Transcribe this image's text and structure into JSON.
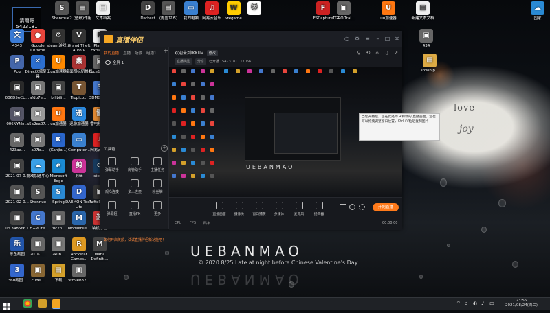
{
  "desktop": {
    "icons": [
      {
        "label": "4343",
        "color": "#3a7bd5",
        "glyph": "文"
      },
      {
        "label": "Pcq",
        "color": "#4466aa",
        "glyph": "P"
      },
      {
        "label": "006D5eCU...",
        "color": "#2a2a2a",
        "glyph": "▣"
      },
      {
        "label": "006NYMe...",
        "color": "#555566",
        "glyph": "▣"
      },
      {
        "label": "423aa...",
        "color": "#666",
        "glyph": "▣"
      },
      {
        "label": "2021-07-0...",
        "color": "#444",
        "glyph": "▣"
      },
      {
        "label": "2021-02-0...",
        "color": "#555",
        "glyph": "▣"
      },
      {
        "label": "uri.348566...",
        "color": "#444",
        "glyph": "▣"
      },
      {
        "label": "乐鱼截图",
        "color": "#2255aa",
        "glyph": "乐"
      },
      {
        "label": "360截图...",
        "color": "#3366cc",
        "glyph": "3"
      },
      {
        "label": "Google Chrome",
        "color": "#e8453c",
        "glyph": "●"
      },
      {
        "label": "DirectX修复工具",
        "color": "#2c6fcf",
        "glyph": "✕"
      },
      {
        "label": "afdb7e...",
        "color": "#777",
        "glyph": "▣"
      },
      {
        "label": "a5a2ca07...",
        "color": "#999",
        "glyph": "▣"
      },
      {
        "label": "a07b...",
        "color": "#777",
        "glyph": "▣"
      },
      {
        "label": "游戏加速中心",
        "color": "#3aa0e8",
        "glyph": "☁"
      },
      {
        "label": "Shennue",
        "color": "#555",
        "glyph": "S"
      },
      {
        "label": "CH+PLite...",
        "color": "#4477cc",
        "glyph": "C"
      },
      {
        "label": "20161...",
        "color": "#666",
        "glyph": "▣"
      },
      {
        "label": "cube...",
        "color": "#886633",
        "glyph": "▣"
      },
      {
        "label": "steam游戏...",
        "color": "#333",
        "glyph": "⚙"
      },
      {
        "label": "uu加速器",
        "color": "#ff8a00",
        "glyph": "U"
      },
      {
        "label": "bilibili...",
        "color": "#444",
        "glyph": "▣"
      },
      {
        "label": "uu加速器",
        "color": "#ff7711",
        "glyph": "U"
      },
      {
        "label": "(Kanjia...)",
        "color": "#2a66cc",
        "glyph": "K"
      },
      {
        "label": "Microsoft Edge",
        "color": "#1a8ad4",
        "glyph": "e"
      },
      {
        "label": "Spring",
        "color": "#2a8ad4",
        "glyph": "S"
      },
      {
        "label": "ruc2n...",
        "color": "#666",
        "glyph": "▣"
      },
      {
        "label": "2kun...",
        "color": "#777",
        "glyph": "▣"
      },
      {
        "label": "下载",
        "color": "#d4a02a",
        "glyph": "▤"
      },
      {
        "label": "Grand Theft Auto V",
        "color": "#333",
        "glyph": "V"
      },
      {
        "label": "桌面图标切换器",
        "color": "#aa3333",
        "glyph": "桌"
      },
      {
        "label": "Tropico...",
        "color": "#775533",
        "glyph": "T"
      },
      {
        "label": "迅游加速器",
        "color": "#2a88dd",
        "glyph": "迅"
      },
      {
        "label": "Computer...",
        "color": "#3a80d0",
        "glyph": "▭"
      },
      {
        "label": "剪辑",
        "color": "#cc3399",
        "glyph": "剪"
      },
      {
        "label": "DAEMON Tools Lite",
        "color": "#3366cc",
        "glyph": "D"
      },
      {
        "label": "MobileFile...",
        "color": "#2a66aa",
        "glyph": "M"
      },
      {
        "label": "Rockstar Games...",
        "color": "#dd9922",
        "glyph": "R"
      },
      {
        "label": "9fd9eb37...",
        "color": "#666",
        "glyph": "▣"
      },
      {
        "label": "Planet Explorers",
        "color": "#eeeeee",
        "glyph": "P"
      },
      {
        "label": "2bce1153...",
        "color": "#666",
        "glyph": "▣"
      },
      {
        "label": "3DMGAM...",
        "color": "#4477cc",
        "glyph": "3"
      },
      {
        "label": "雷电模拟器",
        "color": "#dd8833",
        "glyph": "雷"
      },
      {
        "label": "网易云音乐",
        "color": "#dd2222",
        "glyph": "♫"
      },
      {
        "label": "steam",
        "color": "#173a5e",
        "glyph": "⚙"
      },
      {
        "label": "RaffeRide...",
        "color": "#333",
        "glyph": "▣"
      },
      {
        "label": "装机必备",
        "color": "#cc3333",
        "glyph": "装"
      },
      {
        "label": "Mafia Definiti...",
        "color": "#444",
        "glyph": "M"
      },
      {
        "label": "Shenmue2",
        "color": "#555",
        "glyph": "S"
      },
      {
        "label": "(壁纸)作用",
        "color": "#555",
        "glyph": "▤"
      },
      {
        "label": "文本档案",
        "color": "#eee",
        "glyph": "▤"
      },
      {
        "label": "Darkest",
        "color": "#444",
        "glyph": "D"
      },
      {
        "label": "(魔兽世界)",
        "color": "#555",
        "glyph": "▤"
      },
      {
        "label": "我的电脑",
        "color": "#3a80d0",
        "glyph": "▭"
      },
      {
        "label": "网易云音乐",
        "color": "#dd2222",
        "glyph": "♫"
      },
      {
        "label": "wegame",
        "color": "#ffcc00",
        "glyph": "W"
      },
      {
        "label": "",
        "color": "#ffffff",
        "glyph": "🐱"
      },
      {
        "label": "FSCapture",
        "color": "#cc2222",
        "glyph": "F"
      },
      {
        "label": "TGRO.Trai...",
        "color": "#666",
        "glyph": "▣"
      },
      {
        "label": "uu加速器",
        "color": "#ff7711",
        "glyph": "U"
      },
      {
        "label": "新建文本文档",
        "color": "#eeeeee",
        "glyph": "▤"
      },
      {
        "label": "国家",
        "color": "#2a8ad4",
        "glyph": "☁"
      },
      {
        "label": "434",
        "color": "#666",
        "glyph": "▣"
      },
      {
        "label": "srcwhip...",
        "color": "#ddaa44",
        "glyph": "▤"
      }
    ],
    "watermark_name": "清雨哥",
    "watermark_id": "5423181",
    "wallpaper_text": {
      "love": "love",
      "joy": "joy",
      "brand": "UEBANMAO",
      "subtitle": "© 2020 8/25 Late at night before Chinese Valentine's Day"
    }
  },
  "app": {
    "title": "直播伴侣",
    "window_buttons": [
      "○",
      "⚙",
      "≡",
      "–",
      "□",
      "✕"
    ],
    "sidebar": {
      "tabs": [
        {
          "label": "我的直播",
          "active": true
        },
        {
          "label": "直播",
          "active": false
        },
        {
          "label": "场景",
          "active": false
        },
        {
          "label": "组播1",
          "active": false
        }
      ],
      "add": "+",
      "scene": "全屏 1",
      "tools_title": "工具箱",
      "tools_add": "+",
      "tools": [
        {
          "label": "弹幕助手"
        },
        {
          "label": "房管助手"
        },
        {
          "label": "主播任务"
        },
        {
          "label": "观众连麦"
        },
        {
          "label": "多人连麦"
        },
        {
          "label": "粉丝牌"
        },
        {
          "label": "弹幕姬"
        },
        {
          "label": "直播PK"
        },
        {
          "label": "更多"
        }
      ],
      "notice": "如何开启美颜，试试直播伴侣新功能吧！"
    },
    "header": {
      "welcome": "欢迎来到IKKUV",
      "welcome_tag": "修改",
      "info": [
        "直播类型",
        "分享",
        "已开播",
        "5423181",
        "17056"
      ],
      "icons": [
        "♀",
        "⟲",
        "⌂",
        "♫",
        "↗"
      ]
    },
    "preview": {
      "brand": "UEBANMAO"
    },
    "bottombar": {
      "items": [
        {
          "label": "直播画面"
        },
        {
          "label": "摄像头"
        },
        {
          "label": "窗口捕获"
        },
        {
          "label": "多媒体"
        },
        {
          "label": "麦克风"
        },
        {
          "label": "扬声器"
        }
      ],
      "live_button": "开始直播",
      "timer": "00:00:00",
      "stats": [
        "CPU",
        "FPS",
        "码率"
      ]
    }
  },
  "tooltip": {
    "text": "当您开播后，您在此处为 +和你的 直播画面，您也可以拖拽调整窗口位置，Ctrl+V粘贴复制图片"
  },
  "taskbar": {
    "time": "23:55",
    "date": "2021/08/24(周二)",
    "tray": [
      "^",
      "⌂",
      "◐",
      "♪",
      "中"
    ]
  }
}
